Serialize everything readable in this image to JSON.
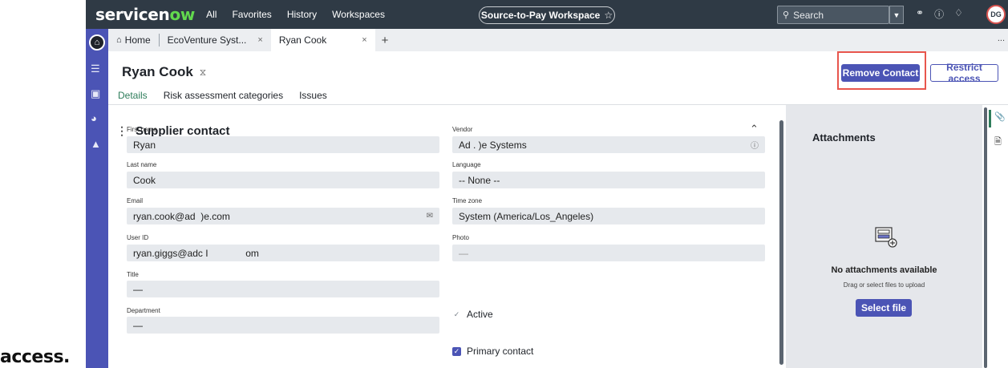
{
  "caption": "access.",
  "topbar": {
    "logo_a": "servicen",
    "logo_ow": "ow",
    "nav": [
      "All",
      "Favorites",
      "History",
      "Workspaces"
    ],
    "workspace": "Source-to-Pay Workspace",
    "workspace_star": "☆",
    "search_placeholder": "Search",
    "avatar_initials": "DG"
  },
  "tabs": [
    {
      "label": "Home"
    },
    {
      "label": "EcoVenture Syst...",
      "close": "×"
    },
    {
      "label": "Ryan Cook",
      "close": "×"
    }
  ],
  "tab_add": "+",
  "tab_more": "...",
  "record": {
    "title": "Ryan Cook",
    "remove_button": "Remove Contact",
    "restrict_button": "Restrict access"
  },
  "subtabs": [
    "Details",
    "Risk assessment categories",
    "Issues"
  ],
  "section": {
    "title": "Supplier contact"
  },
  "fields": {
    "first_name": {
      "label": "First name",
      "value": "Ryan"
    },
    "last_name": {
      "label": "Last name",
      "value": "Cook"
    },
    "email": {
      "label": "Email",
      "value": "ryan.cook@ad  )e.com"
    },
    "user_id": {
      "label": "User ID",
      "value": "ryan.giggs@adc I              om"
    },
    "title": {
      "label": "Title",
      "value": "—"
    },
    "department": {
      "label": "Department",
      "value": "—"
    },
    "vendor": {
      "label": "Vendor",
      "value": "Ad . )e Systems"
    },
    "language": {
      "label": "Language",
      "value": "-- None --"
    },
    "time_zone": {
      "label": "Time zone",
      "value": "System (America/Los_Angeles)"
    },
    "photo": {
      "label": "Photo",
      "value": "—"
    },
    "active": {
      "label": "Active",
      "checked": false
    },
    "primary_contact": {
      "label": "Primary contact",
      "checked": true
    }
  },
  "attachments": {
    "title": "Attachments",
    "empty": "No attachments available",
    "hint": "Drag or select files to upload",
    "select_button": "Select file"
  },
  "colors": {
    "brand": "#4b54b5",
    "topbar": "#2f3a45",
    "highlight": "#e8564d",
    "active_tab": "#2e7d5b"
  }
}
